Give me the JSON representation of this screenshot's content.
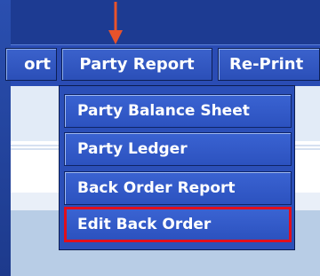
{
  "menubar": {
    "items": [
      {
        "label": "ort"
      },
      {
        "label": "Party Report"
      },
      {
        "label": "Re-Print"
      }
    ]
  },
  "dropdown": {
    "items": [
      {
        "label": "Party Balance Sheet"
      },
      {
        "label": "Party Ledger"
      },
      {
        "label": "Back Order Report"
      },
      {
        "label": "Edit Back Order",
        "highlighted": true
      }
    ]
  },
  "annotation": {
    "arrow_color": "#e8532b",
    "highlight_color": "#e10f1c"
  },
  "colors": {
    "menu_blue": "#2b4fb8",
    "background_blue": "#1f3e93"
  }
}
